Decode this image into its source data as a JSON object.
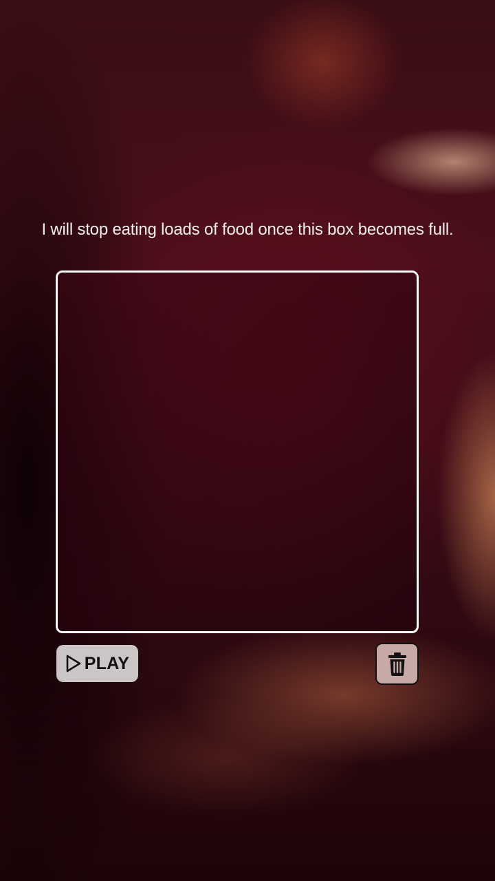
{
  "caption": "I will stop eating loads of food once this box becomes full.",
  "controls": {
    "play_label": "PLAY",
    "play_icon": "play-triangle-icon",
    "delete_icon": "trash-icon"
  },
  "colors": {
    "box_border": "#ffffff",
    "play_button_bg": "#cbc5c5",
    "trash_button_bg": "#c7aaa5"
  }
}
